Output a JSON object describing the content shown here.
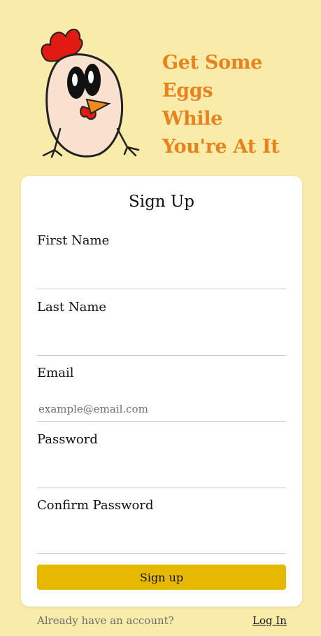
{
  "header": {
    "tagline_lines": [
      "Get Some",
      "Eggs",
      "While",
      "You're At It"
    ],
    "accent_color": "#e8821e",
    "mascot_icon": "chicken-egg-mascot"
  },
  "card": {
    "title": "Sign Up",
    "fields": [
      {
        "label": "First Name",
        "value": "",
        "placeholder": ""
      },
      {
        "label": "Last Name",
        "value": "",
        "placeholder": ""
      },
      {
        "label": "Email",
        "value": "",
        "placeholder": "example@email.com"
      },
      {
        "label": "Password",
        "value": "",
        "placeholder": ""
      },
      {
        "label": "Confirm Password",
        "value": "",
        "placeholder": ""
      }
    ],
    "submit_label": "Sign up",
    "button_color": "#e6b800"
  },
  "footer": {
    "prompt": "Already have an account?",
    "login_label": "Log In"
  },
  "background_color": "#f9ecab"
}
